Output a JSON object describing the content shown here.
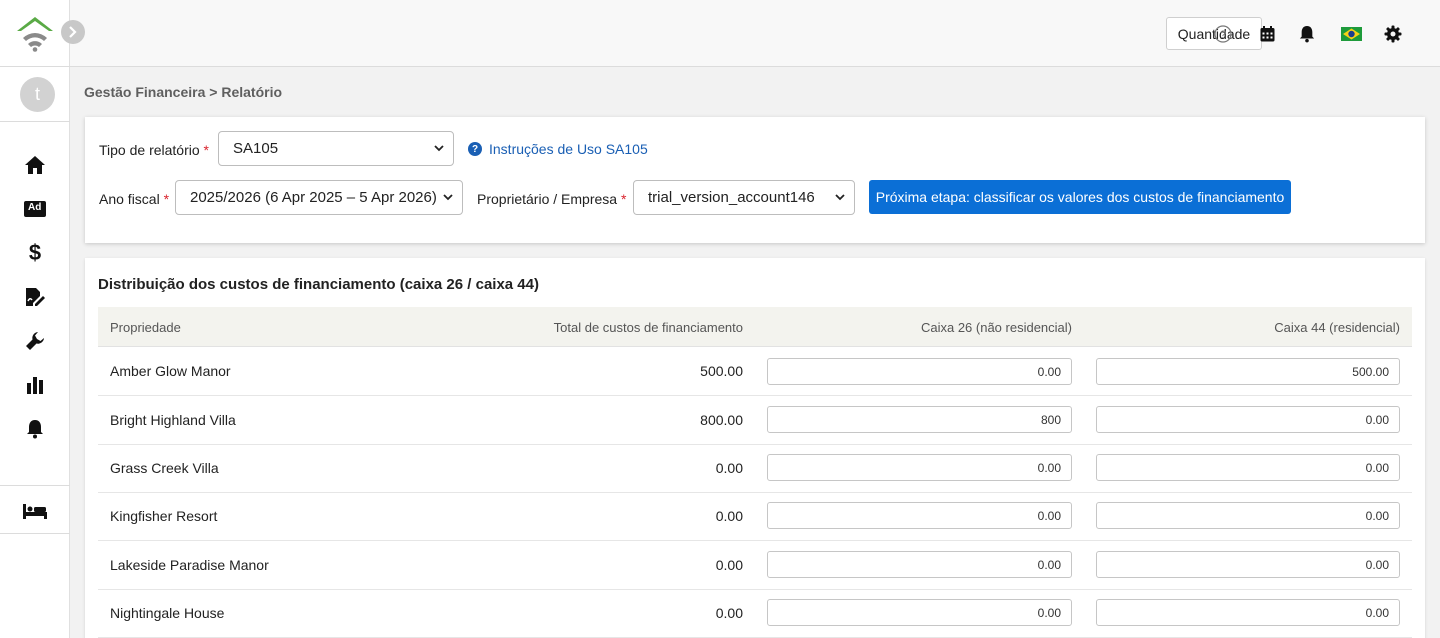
{
  "sidebar": {
    "avatar_initial": "t",
    "icons": [
      "home-icon",
      "ad-icon",
      "dollar-icon",
      "signature-icon",
      "wrench-icon",
      "bar-chart-icon",
      "bell-icon",
      "bed-icon"
    ],
    "ad_label": "Ad"
  },
  "topbar": {
    "quantity_label": "Quantidade",
    "icons": [
      "help-icon",
      "calendar-icon",
      "bell-icon",
      "brazil-flag-icon",
      "gear-icon"
    ]
  },
  "breadcrumb": "Gestão Financeira > Relatório",
  "filters": {
    "report_type_label": "Tipo de relatório",
    "report_type_value": "SA105",
    "instructions_link": "Instruções de Uso SA105",
    "fiscal_year_label": "Ano fiscal",
    "fiscal_year_value": "2025/2026 (6 Apr 2025 – 5 Apr 2026)",
    "owner_label": "Proprietário / Empresa",
    "owner_value": "trial_version_account146",
    "required_mark": "*",
    "next_step_button": "Próxima etapa: classificar os valores dos custos de financiamento"
  },
  "table": {
    "title": "Distribuição dos custos de financiamento (caixa 26 / caixa 44)",
    "headers": {
      "property": "Propriedade",
      "total": "Total de custos de financiamento",
      "box26": "Caixa 26 (não residencial)",
      "box44": "Caixa 44 (residencial)"
    },
    "rows": [
      {
        "property": "Amber Glow Manor",
        "total": "500.00",
        "box26": "0.00",
        "box44": "500.00"
      },
      {
        "property": "Bright Highland Villa",
        "total": "800.00",
        "box26": "800",
        "box44": "0.00"
      },
      {
        "property": "Grass Creek Villa",
        "total": "0.00",
        "box26": "0.00",
        "box44": "0.00"
      },
      {
        "property": "Kingfisher Resort",
        "total": "0.00",
        "box26": "0.00",
        "box44": "0.00"
      },
      {
        "property": "Lakeside Paradise Manor",
        "total": "0.00",
        "box26": "0.00",
        "box44": "0.00"
      },
      {
        "property": "Nightingale House",
        "total": "0.00",
        "box26": "0.00",
        "box44": "0.00"
      }
    ]
  },
  "colors": {
    "primary": "#0b6fd6",
    "link": "#1a5fb4",
    "required": "#d9232d",
    "logo_green": "#5aaa46",
    "logo_gray": "#8a8a8a"
  }
}
